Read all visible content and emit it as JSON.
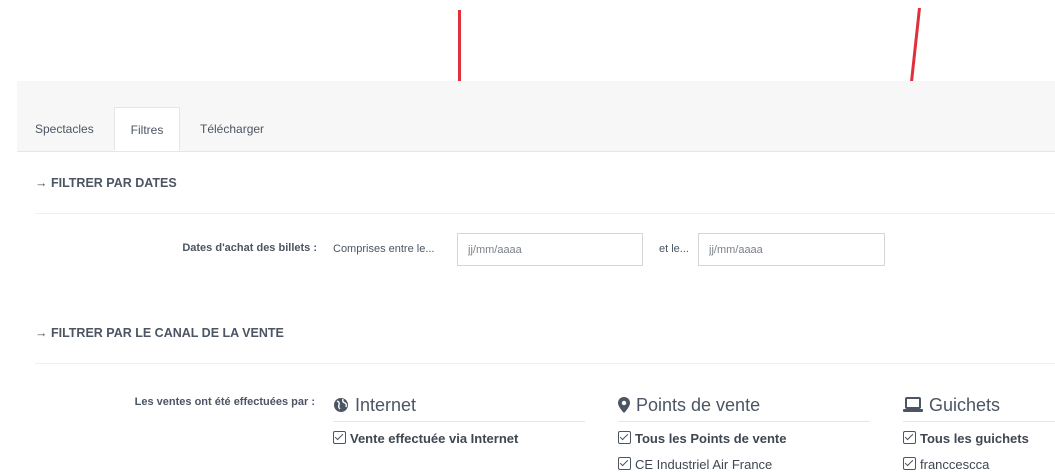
{
  "tabs": [
    "Spectacles",
    "Filtres",
    "Télécharger"
  ],
  "sections": {
    "dates": {
      "title": "→ FILTRER PAR DATES",
      "label": "Dates d'achat des billets :",
      "between_text": "Comprises entre le...",
      "start_placeholder": "jj/mm/aaaa",
      "and_text": "et le...",
      "end_placeholder": "jj/mm/aaaa"
    },
    "canal": {
      "title": "→ FILTRER PAR LE CANAL DE LA VENTE",
      "label": "Les ventes ont été effectuées par :",
      "columns": [
        {
          "title": "Internet",
          "icon": "globe-icon",
          "items": [
            {
              "label": "Vente effectuée via Internet",
              "checked": true,
              "bold": true
            }
          ]
        },
        {
          "title": "Points de vente",
          "icon": "map-marker-icon",
          "items": [
            {
              "label": "Tous les Points de vente",
              "checked": true,
              "bold": true
            },
            {
              "label": "CE Industriel Air France",
              "checked": true,
              "bold": false
            }
          ]
        },
        {
          "title": "Guichets",
          "icon": "laptop-icon",
          "items": [
            {
              "label": "Tous les guichets",
              "checked": true,
              "bold": true
            },
            {
              "label": "franccescca",
              "checked": true,
              "bold": false
            }
          ]
        }
      ]
    }
  },
  "colors": {
    "annotation_arrow": "#e0303b",
    "text": "#4b5563",
    "border": "#d3d6db"
  }
}
